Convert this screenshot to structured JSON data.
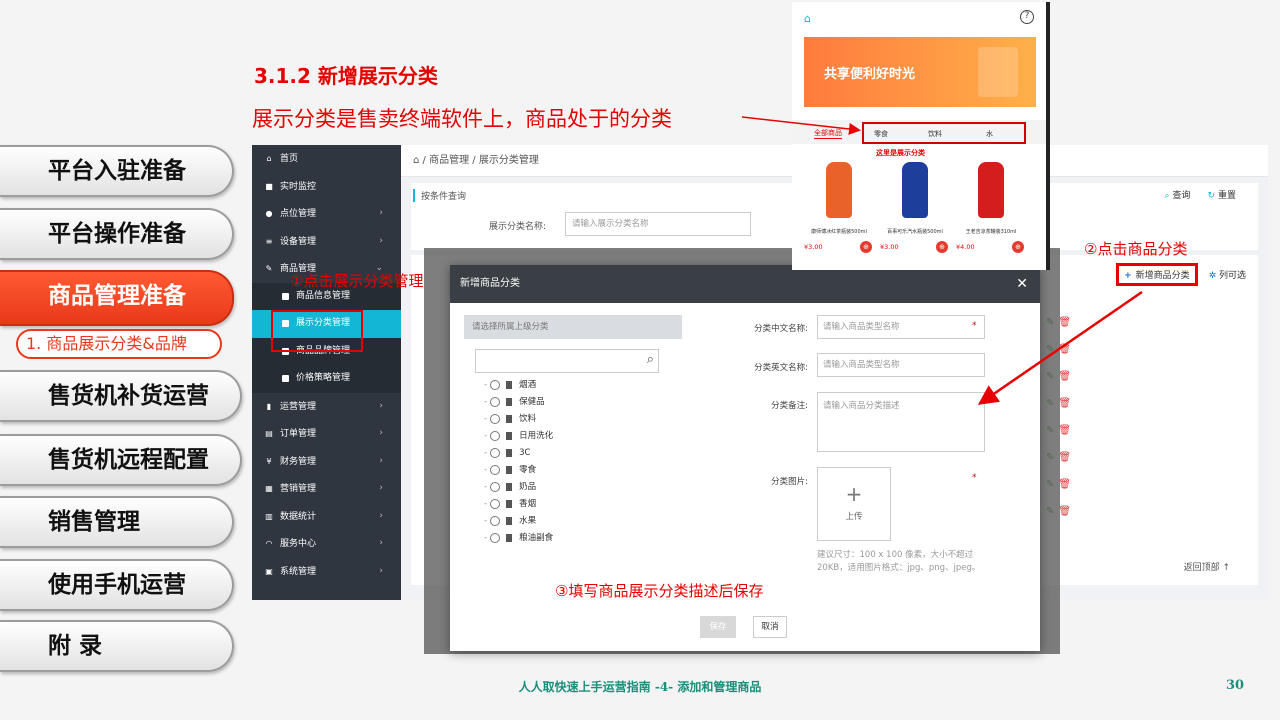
{
  "slide": {
    "title": "3.1.2 新增展示分类",
    "subtitle": "展示分类是售卖终端软件上，商品处于的分类",
    "footer": "人人取快速上手运营指南 -4- 添加和管理商品",
    "page_number": "30"
  },
  "chapters": [
    {
      "label": "平台入驻准备",
      "active": false
    },
    {
      "label": "平台操作准备",
      "active": false
    },
    {
      "label": "商品管理准备",
      "active": true
    },
    {
      "label": "售货机补货运营",
      "active": false
    },
    {
      "label": "售货机远程配置",
      "active": false
    },
    {
      "label": "销售管理",
      "active": false
    },
    {
      "label": "使用手机运营",
      "active": false
    },
    {
      "label": "附 录",
      "active": false
    }
  ],
  "chapter_sub": "1. 商品展示分类&品牌",
  "admin": {
    "sidebar": [
      {
        "icon": "home-icon",
        "glyph": "⌂",
        "label": "首页",
        "sub": false
      },
      {
        "icon": "video-icon",
        "glyph": "■",
        "label": "实时监控",
        "sub": false
      },
      {
        "icon": "location-icon",
        "glyph": "●",
        "label": "点位管理",
        "sub": false,
        "arrow": "›"
      },
      {
        "icon": "device-icon",
        "glyph": "≡",
        "label": "设备管理",
        "sub": false,
        "arrow": "›"
      },
      {
        "icon": "edit-icon",
        "glyph": "✎",
        "label": "商品管理",
        "sub": false,
        "arrow": "⌄"
      },
      {
        "icon": "square-icon",
        "glyph": "",
        "label": "商品信息管理",
        "sub": true
      },
      {
        "icon": "square-icon",
        "glyph": "",
        "label": "展示分类管理",
        "sub": true,
        "current": true
      },
      {
        "icon": "square-icon",
        "glyph": "",
        "label": "商品品牌管理",
        "sub": true
      },
      {
        "icon": "square-icon",
        "glyph": "",
        "label": "价格策略管理",
        "sub": true
      },
      {
        "icon": "bookmark-icon",
        "glyph": "▮",
        "label": "运营管理",
        "sub": false,
        "arrow": "›"
      },
      {
        "icon": "order-icon",
        "glyph": "▤",
        "label": "订单管理",
        "sub": false,
        "arrow": "›"
      },
      {
        "icon": "yen-icon",
        "glyph": "¥",
        "label": "财务管理",
        "sub": false,
        "arrow": "›"
      },
      {
        "icon": "marketing-icon",
        "glyph": "▦",
        "label": "营销管理",
        "sub": false,
        "arrow": "›"
      },
      {
        "icon": "chart-icon",
        "glyph": "▥",
        "label": "数据统计",
        "sub": false,
        "arrow": "›"
      },
      {
        "icon": "headset-icon",
        "glyph": "◠",
        "label": "服务中心",
        "sub": false,
        "arrow": "›"
      },
      {
        "icon": "system-icon",
        "glyph": "▣",
        "label": "系统管理",
        "sub": false,
        "arrow": "›"
      }
    ],
    "breadcrumb": [
      "商品管理",
      "展示分类管理"
    ],
    "filter": {
      "header": "按条件查询",
      "label": "展示分类名称:",
      "placeholder": "请输入展示分类名称",
      "query": "查询",
      "reset": "重置"
    },
    "list": {
      "new_button": "新增商品分类",
      "column_select": "列可选",
      "back_top": "返回顶部"
    }
  },
  "modal": {
    "title": "新增商品分类",
    "parent_placeholder": "请选择所属上级分类",
    "tree": [
      "烟酒",
      "保健品",
      "饮料",
      "日用洗化",
      "3C",
      "零食",
      "奶品",
      "香烟",
      "水果",
      "粮油副食"
    ],
    "fields": {
      "cn_label": "分类中文名称:",
      "cn_placeholder": "请输入商品类型名称",
      "en_label": "分类英文名称:",
      "en_placeholder": "请输入商品类型名称",
      "remark_label": "分类备注:",
      "remark_placeholder": "请输入商品分类描述",
      "image_label": "分类图片:",
      "upload": "上传",
      "hint": "建议尺寸：100 x 100 像素，大小不超过20KB，适用图片格式：jpg、png、jpeg。"
    },
    "save": "保存",
    "cancel": "取消"
  },
  "phone": {
    "banner": "共享便利好时光",
    "tabs": [
      "全部商品",
      "零食",
      "饮料",
      "水"
    ],
    "note": "这里是展示分类",
    "products": [
      {
        "name": "康师傅冰红茶瓶装500ml",
        "price": "¥3.00",
        "color": "#e8622a"
      },
      {
        "name": "百事可乐汽水瓶装500ml",
        "price": "¥3.00",
        "color": "#1e3e9c"
      },
      {
        "name": "王老吉凉茶罐装310ml",
        "price": "¥4.00",
        "color": "#d41e1e"
      }
    ]
  },
  "annotations": {
    "step1": "①点击展示分类管理",
    "step2": "②点击商品分类",
    "step3": "③填写商品展示分类描述后保存"
  }
}
